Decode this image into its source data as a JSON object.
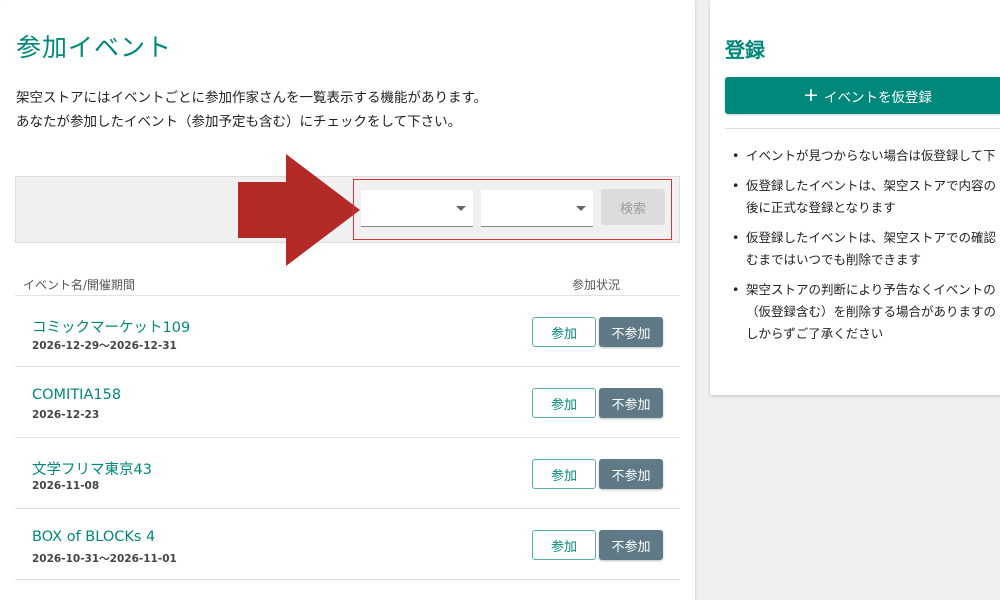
{
  "main": {
    "title": "参加イベント",
    "description_line1": "架空ストアにはイベントごとに参加作家さんを一覧表示する機能があります。",
    "description_line2": "あなたが参加したイベント（参加予定も含む）にチェックをして下さい。",
    "filter": {
      "select1_value": "",
      "select2_value": "",
      "search_label": "検索"
    },
    "list_header": {
      "name_col": "イベント名/開催期間",
      "status_col": "参加状況"
    },
    "events": [
      {
        "name": "コミックマーケット109",
        "date": "2026-12-29～2026-12-31",
        "join": "参加",
        "decline": "不参加"
      },
      {
        "name": "COMITIA158",
        "date": "2026-12-23",
        "join": "参加",
        "decline": "不参加"
      },
      {
        "name": "文学フリマ東京43",
        "date": "2026-11-08",
        "join": "参加",
        "decline": "不参加"
      },
      {
        "name": "BOX of BLOCKs 4",
        "date": "2026-10-31～2026-11-01",
        "join": "参加",
        "decline": "不参加"
      }
    ]
  },
  "side": {
    "title": "登録",
    "register_label": "イベントを仮登録",
    "notes": [
      [
        "イベントが見つからない場合は仮登録して下"
      ],
      [
        "仮登録したイベントは、架空ストアで内容の",
        "後に正式な登録となります"
      ],
      [
        "仮登録したイベントは、架空ストアでの確認",
        "むまではいつでも削除できます"
      ],
      [
        "架空ストアの判断により予告なくイベントの",
        "（仮登録含む）を削除する場合がありますの",
        "しからずご了承ください"
      ]
    ]
  },
  "colors": {
    "accent": "#00897b",
    "decline_button": "#5f7a86",
    "arrow": "#b32a26",
    "highlight": "#d93636"
  }
}
